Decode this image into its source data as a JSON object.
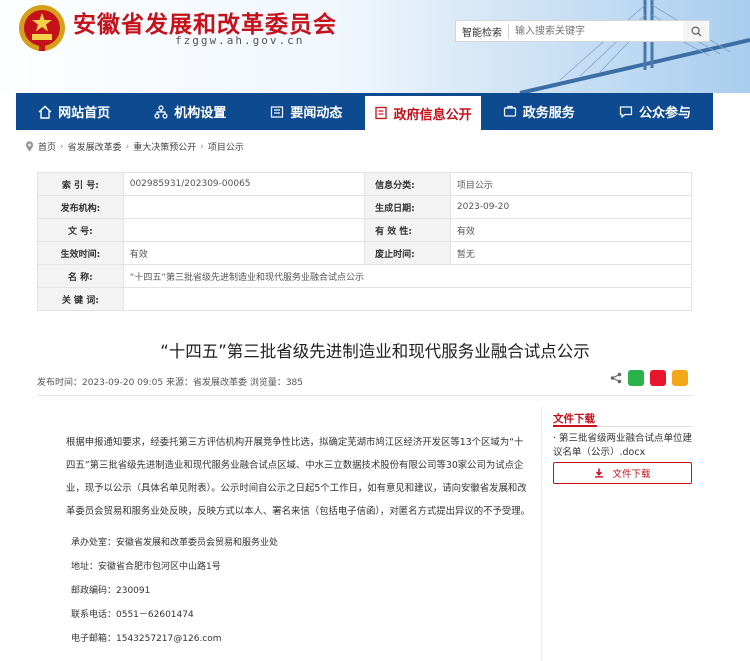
{
  "header": {
    "site_title": "安徽省发展和改革委员会",
    "domain": "fzggw.ah.gov.cn",
    "search_label": "智能检索",
    "search_placeholder": "输入搜索关键字"
  },
  "nav": [
    {
      "label": "网站首页",
      "icon": "home-icon"
    },
    {
      "label": "机构设置",
      "icon": "org-chart-icon"
    },
    {
      "label": "要闻动态",
      "icon": "news-icon"
    },
    {
      "label": "政府信息公开",
      "icon": "document-icon",
      "active": true
    },
    {
      "label": "政务服务",
      "icon": "service-icon"
    },
    {
      "label": "公众参与",
      "icon": "chat-icon"
    }
  ],
  "breadcrumb": [
    "首页",
    "省发展改革委",
    "重大决策预公开",
    "项目公示"
  ],
  "info": {
    "index_no_label": "索 引 号:",
    "index_no": "002985931/202309-00065",
    "category_label": "信息分类:",
    "category": "项目公示",
    "publisher_label": "发布机构:",
    "publisher": "",
    "date_label": "生成日期:",
    "date": "2023-09-20",
    "doc_no_label": "文      号:",
    "doc_no": "",
    "validity_label": "有 效 性:",
    "validity": "有效",
    "effective_label": "生效时间:",
    "effective": "有效",
    "expiry_label": "废止时间:",
    "expiry": "暂无",
    "name_label": "名      称:",
    "name": "“十四五”第三批省级先进制造业和现代服务业融合试点公示",
    "keywords_label": "关 键 词:",
    "keywords": ""
  },
  "article": {
    "title": "“十四五”第三批省级先进制造业和现代服务业融合试点公示",
    "meta": "发布时间：2023-09-20 09:05  来源：省发展改革委  浏览量：385",
    "paragraph": "根据申报通知要求，经委托第三方评估机构开展竞争性比选，拟确定芜湖市鸠江区经济开发区等13个区域为“十四五”第三批省级先进制造业和现代服务业融合试点区域、中水三立数据技术股份有限公司等30家公司为试点企业，现予以公示（具体名单见附表）。公示时间自公示之日起5个工作日，如有意见和建议，请向安徽省发展和改革委员会贸易和服务业处反映，反映方式以本人、署名来信（包括电子信函），对匿名方式提出异议的不予受理。",
    "office": "承办处室：安徽省发展和改革委员会贸易和服务业处",
    "address": "地址：安徽省合肥市包河区中山路1号",
    "postcode": "邮政编码：230091",
    "phone": "联系电话：0551－62601474",
    "email": "电子邮箱：1543257217@126.com"
  },
  "sidebar": {
    "title": "文件下载",
    "file": "第三批省级两业融合试点单位建议名单（公示）.docx",
    "download_label": "文件下载"
  },
  "colors": {
    "brand_red": "#c4111a",
    "nav_blue": "#0e4a8f"
  }
}
